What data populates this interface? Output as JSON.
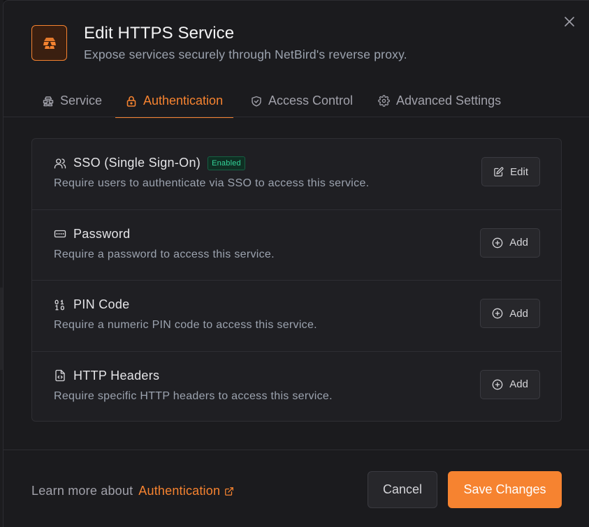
{
  "dialog": {
    "title": "Edit HTTPS Service",
    "subtitle": "Expose services securely through NetBird's reverse proxy.",
    "header_icon": "service-logo-icon",
    "close_icon": "close-icon"
  },
  "tabs": [
    {
      "label": "Service",
      "icon": "service-icon",
      "active": false
    },
    {
      "label": "Authentication",
      "icon": "lock-icon",
      "active": true
    },
    {
      "label": "Access Control",
      "icon": "shield-icon",
      "active": false
    },
    {
      "label": "Advanced Settings",
      "icon": "gear-icon",
      "active": false
    }
  ],
  "auth_methods": [
    {
      "title": "SSO (Single Sign-On)",
      "badge": "Enabled",
      "description": "Require users to authenticate via SSO to access this service.",
      "icon": "users-icon",
      "button_label": "Edit",
      "button_icon": "edit-icon"
    },
    {
      "title": "Password",
      "description": "Require a password to access this service.",
      "icon": "password-icon",
      "button_label": "Add",
      "button_icon": "plus-circle-icon"
    },
    {
      "title": "PIN Code",
      "description": "Require a numeric PIN code to access this service.",
      "icon": "pin-icon",
      "button_label": "Add",
      "button_icon": "plus-circle-icon"
    },
    {
      "title": "HTTP Headers",
      "description": "Require specific HTTP headers to access this service.",
      "icon": "file-code-icon",
      "button_label": "Add",
      "button_icon": "plus-circle-icon"
    }
  ],
  "footer": {
    "learn_prefix": "Learn more about",
    "learn_link": "Authentication",
    "cancel_label": "Cancel",
    "save_label": "Save Changes"
  },
  "colors": {
    "accent": "#f68330",
    "success": "#34d399",
    "background": "#1b1b1e"
  }
}
